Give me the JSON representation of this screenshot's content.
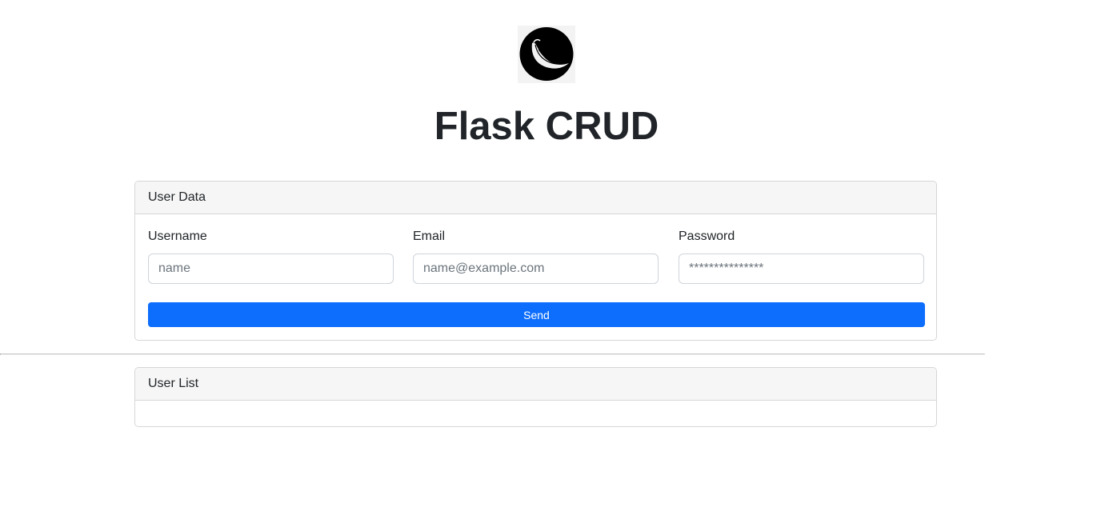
{
  "header": {
    "logo_icon": "flask-logo-icon",
    "title": "Flask CRUD"
  },
  "form_card": {
    "title": "User Data",
    "fields": [
      {
        "label": "Username",
        "placeholder": "name",
        "value": ""
      },
      {
        "label": "Email",
        "placeholder": "name@example.com",
        "value": ""
      },
      {
        "label": "Password",
        "placeholder": "***************",
        "value": ""
      }
    ],
    "submit_label": "Send"
  },
  "list_card": {
    "title": "User List",
    "items": []
  },
  "colors": {
    "primary_button": "#0d6efd",
    "card_header_bg": "#f6f6f6",
    "title_text": "#212529"
  }
}
